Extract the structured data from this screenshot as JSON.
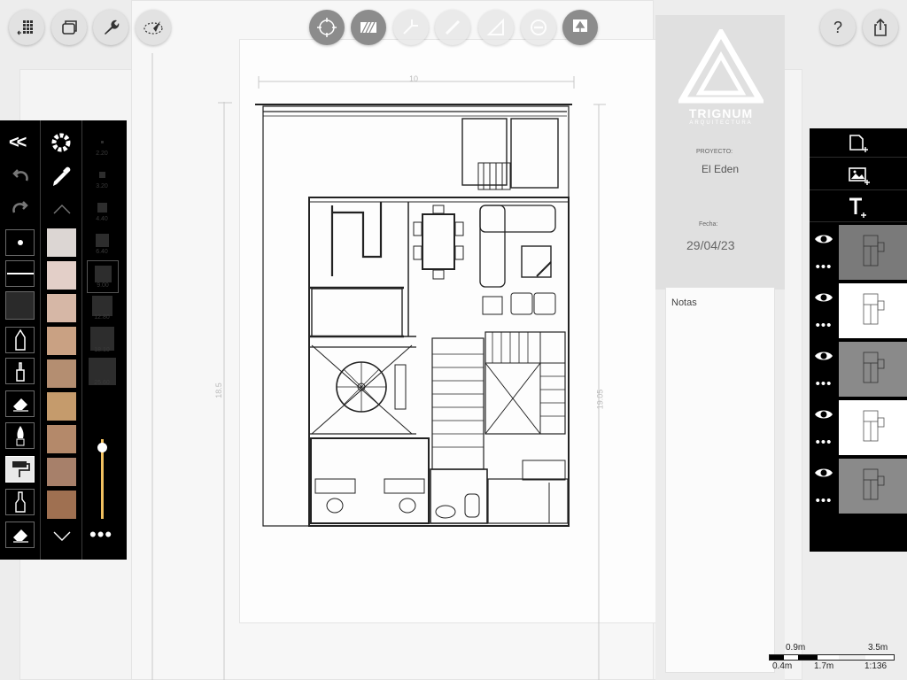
{
  "top_toolbar": {
    "left_tools": [
      "grid-menu-icon",
      "layers-window-icon",
      "wrench-icon",
      "navigate-icon"
    ],
    "center_tools": [
      "select-transform-icon",
      "hatch-icon",
      "angle-icon",
      "line-pen-icon",
      "ruler-triangle-icon",
      "minus-circle-icon",
      "stamp-icon"
    ],
    "right_tools": [
      "help-icon",
      "share-icon"
    ]
  },
  "drawing": {
    "dim_top": "10",
    "dim_left": "18.5",
    "dim_right": "19.05"
  },
  "title_block": {
    "brand": "TRIGNUM",
    "brand_sub": "ARQUITECTURA",
    "project_label": "PROYECTO:",
    "project_value": "El Eden",
    "date_label": "Fecha:",
    "date_value": "29/04/23",
    "notes_label": "Notas"
  },
  "left_panel": {
    "collapse_label": "<<",
    "stroke_sizes": [
      "2.20",
      "3.20",
      "4.40",
      "6.40",
      "9.00",
      "12.80",
      "18.10",
      "25.60"
    ],
    "selected_size": "9.00",
    "colors": [
      "#dcd6d3",
      "#e3cfc8",
      "#d6b7a6",
      "#c9a183",
      "#b48e71",
      "#c59b6c",
      "#b4896a",
      "#a7806a",
      "#9f7051"
    ],
    "slider_level": 0.1
  },
  "right_panel": {
    "tools": [
      "new-page-icon",
      "add-image-icon",
      "add-text-icon"
    ],
    "layers": [
      {
        "name": "layer-1",
        "visible": true
      },
      {
        "name": "layer-2",
        "visible": true
      },
      {
        "name": "layer-3",
        "visible": true
      },
      {
        "name": "layer-4",
        "visible": true
      },
      {
        "name": "layer-5",
        "visible": true
      }
    ]
  },
  "scale_bar": {
    "top_left": "0.9m",
    "top_right": "3.5m",
    "bottom_a": "0.4m",
    "bottom_b": "1.7m",
    "ratio": "1:136"
  }
}
